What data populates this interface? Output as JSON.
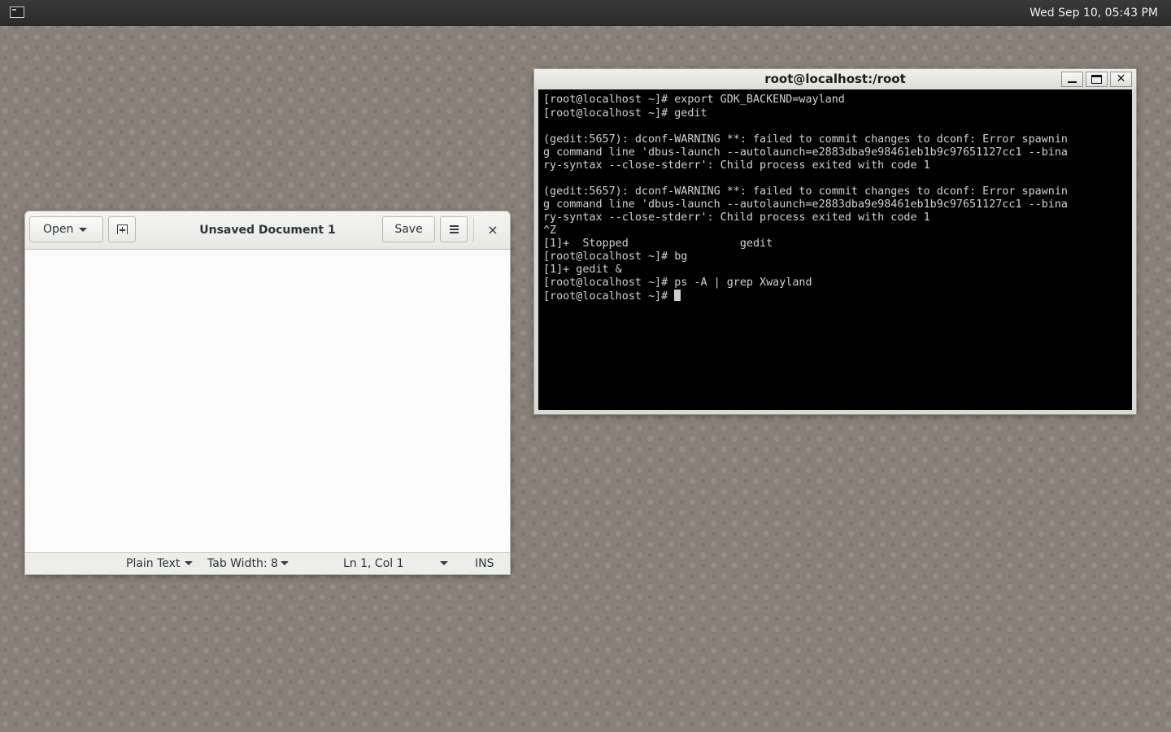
{
  "top_panel": {
    "clock": "Wed Sep 10, 05:43 PM",
    "app_icon": "terminal-icon"
  },
  "gedit": {
    "open_label": "Open",
    "title": "Unsaved Document 1",
    "save_label": "Save",
    "close_glyph": "×",
    "editor_text": "",
    "status": {
      "language": "Plain Text",
      "tab_width": "Tab Width: 8",
      "position": "Ln 1, Col 1",
      "mode": "INS"
    }
  },
  "terminal": {
    "title": "root@localhost:/root",
    "close_glyph": "✕",
    "lines": [
      "[root@localhost ~]# export GDK_BACKEND=wayland",
      "[root@localhost ~]# gedit",
      "",
      "(gedit:5657): dconf-WARNING **: failed to commit changes to dconf: Error spawnin",
      "g command line 'dbus-launch --autolaunch=e2883dba9e98461eb1b9c97651127cc1 --bina",
      "ry-syntax --close-stderr': Child process exited with code 1",
      "",
      "(gedit:5657): dconf-WARNING **: failed to commit changes to dconf: Error spawnin",
      "g command line 'dbus-launch --autolaunch=e2883dba9e98461eb1b9c97651127cc1 --bina",
      "ry-syntax --close-stderr': Child process exited with code 1",
      "^Z",
      "[1]+  Stopped                 gedit",
      "[root@localhost ~]# bg",
      "[1]+ gedit &",
      "[root@localhost ~]# ps -A | grep Xwayland",
      "[root@localhost ~]# "
    ]
  }
}
